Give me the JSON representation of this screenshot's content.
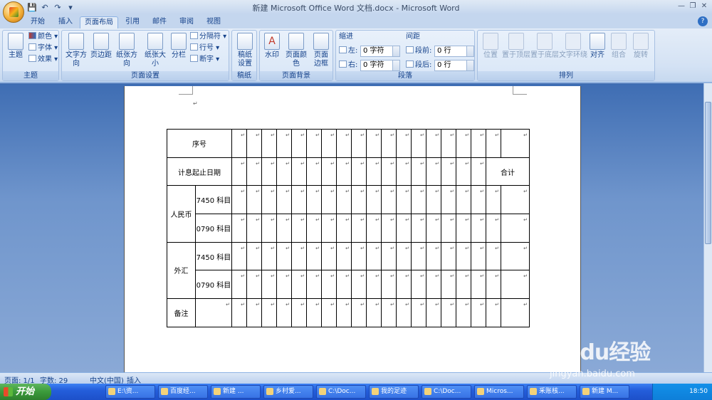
{
  "window": {
    "title": "新建 Microsoft Office Word 文档.docx - Microsoft Word"
  },
  "tabs": [
    "开始",
    "插入",
    "页面布局",
    "引用",
    "邮件",
    "审阅",
    "视图"
  ],
  "active_tab": "页面布局",
  "ribbon": {
    "theme": {
      "label": "主题",
      "themes": "主题",
      "colors": "颜色",
      "fonts": "字体",
      "effects": "效果"
    },
    "page_setup": {
      "label": "页面设置",
      "text_direction": "文字方向",
      "margins": "页边距",
      "orientation": "纸张方向",
      "size": "纸张大小",
      "columns": "分栏",
      "breaks": "分隔符",
      "line_numbers": "行号",
      "hyphenation": "断字"
    },
    "manuscript": {
      "label": "稿纸",
      "setup": "稿纸\n设置"
    },
    "background": {
      "label": "页面背景",
      "watermark": "水印",
      "page_color": "页面颜色",
      "page_borders": "页面\n边框"
    },
    "paragraph": {
      "label": "段落",
      "indent": "缩进",
      "spacing": "间距",
      "left": "左:",
      "right": "右:",
      "before": "段前:",
      "after": "段后:",
      "left_val": "0 字符",
      "right_val": "0 字符",
      "before_val": "0 行",
      "after_val": "0 行"
    },
    "arrange": {
      "label": "排列",
      "position": "位置",
      "bring_front": "置于顶层",
      "send_back": "置于底层",
      "wrap": "文字环绕",
      "align": "对齐",
      "group": "组合",
      "rotate": "旋转"
    }
  },
  "table": {
    "row_seq": "序号",
    "row_dates": "计息起止日期",
    "total": "合计",
    "rmb": "人民币",
    "fx": "外汇",
    "acct1": "7450 科目",
    "acct2": "0790 科目",
    "note": "备注"
  },
  "status": {
    "page": "页面: 1/1",
    "words": "字数: 29",
    "lang": "中文(中国)",
    "mode": "插入"
  },
  "taskbar": {
    "start": "开始",
    "items": [
      "E:\\资...",
      "百度经...",
      "新建 ...",
      "乡村爱...",
      "C:\\Doc...",
      "我的足迹",
      "C:\\Doc...",
      "Micros...",
      "釆账核...",
      "新建 M..."
    ],
    "time": "18:50"
  },
  "watermark": {
    "brand": "Baidu经验",
    "url": "jingyan.baidu.com"
  }
}
